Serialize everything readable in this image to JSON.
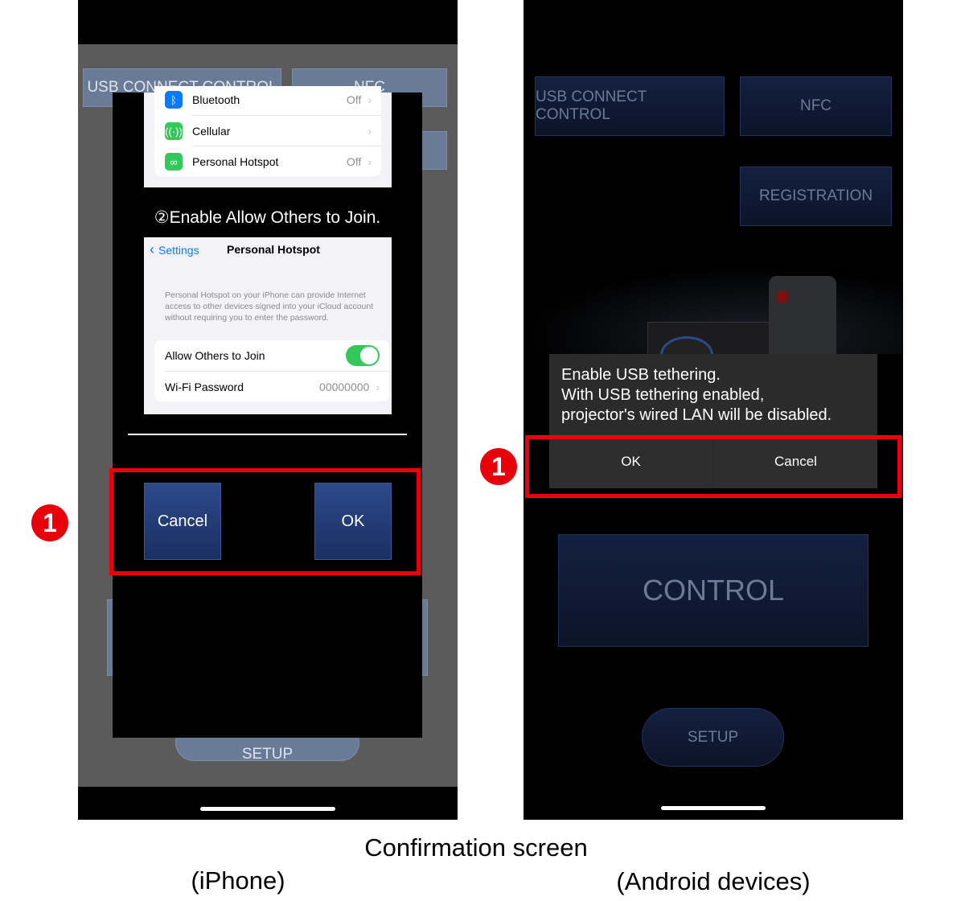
{
  "iphone": {
    "bg_buttons": {
      "usb": "USB CONNECT CONTROL",
      "nfc": "NFC",
      "registration_partial": "N",
      "setup": "SETUP"
    },
    "settings_rows": [
      {
        "label": "Bluetooth",
        "value": "Off",
        "icon": "bluetooth-icon",
        "color": "#0a7aff"
      },
      {
        "label": "Cellular",
        "value": "",
        "icon": "antenna-icon",
        "color": "#34c759"
      },
      {
        "label": "Personal Hotspot",
        "value": "Off",
        "icon": "hotspot-link-icon",
        "color": "#34c759"
      }
    ],
    "step_text": "②Enable Allow Others to Join.",
    "hotspot": {
      "back": "Settings",
      "title": "Personal Hotspot",
      "description": "Personal Hotspot on your iPhone can provide Internet access to other devices signed into your iCloud account without requiring you to enter the password.",
      "allow_label": "Allow Others to Join",
      "allow_on": true,
      "wifi_label": "Wi-Fi Password",
      "wifi_value": "00000000"
    },
    "cancel": "Cancel",
    "ok": "OK"
  },
  "android": {
    "buttons": {
      "usb": "USB CONNECT CONTROL",
      "nfc": "NFC",
      "registration": "REGISTRATION",
      "control": "CONTROL",
      "setup": "SETUP"
    },
    "dialog": {
      "line1": "Enable USB tethering.",
      "line2": "With USB tethering enabled,",
      "line3": "projector's wired LAN will be disabled.",
      "ok": "OK",
      "cancel": "Cancel"
    }
  },
  "badge": "1",
  "highlight_color": "#e8000b",
  "captions": {
    "title": "Confirmation screen",
    "iphone": "(iPhone)",
    "android": "(Android devices)"
  }
}
